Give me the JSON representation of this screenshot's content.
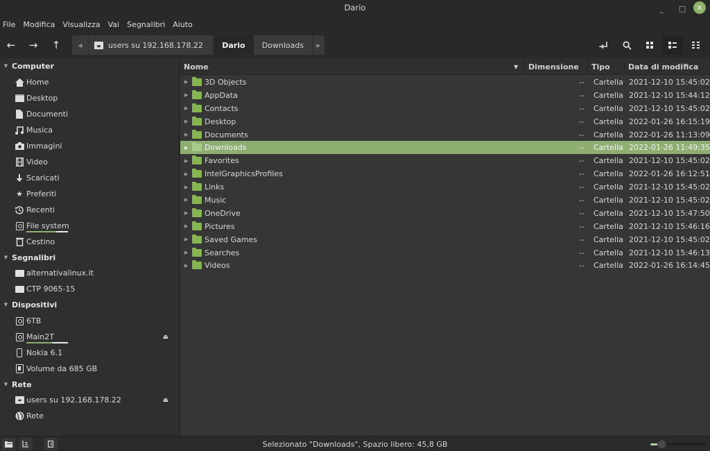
{
  "window": {
    "title": "Dario",
    "minimize_label": "_",
    "maximize_label": "□",
    "close_label": "✕"
  },
  "menubar": [
    "File",
    "Modifica",
    "Visualizza",
    "Vai",
    "Segnalibri",
    "Aiuto"
  ],
  "toolbar": {
    "back_icon": "←",
    "forward_icon": "→",
    "up_icon": "↑",
    "path_left_arrow": "◀",
    "path_right_arrow": "▶",
    "path": [
      {
        "label": "users su 192.168.178.22",
        "icon": "network-share-icon"
      },
      {
        "label": "Dario",
        "active": true
      },
      {
        "label": "Downloads"
      }
    ],
    "toggle_location_icon": "↵",
    "search_icon": "⚲",
    "icon_view_icon": "▦",
    "list_view_icon": "☰",
    "compact_view_icon": "⋮⋮"
  },
  "sidebar": {
    "sections": [
      {
        "title": "Computer",
        "items": [
          {
            "label": "Home",
            "icon": "home-icon"
          },
          {
            "label": "Desktop",
            "icon": "desktop-icon"
          },
          {
            "label": "Documenti",
            "icon": "document-icon"
          },
          {
            "label": "Musica",
            "icon": "music-icon"
          },
          {
            "label": "Immagini",
            "icon": "camera-icon"
          },
          {
            "label": "Video",
            "icon": "film-icon"
          },
          {
            "label": "Scaricati",
            "icon": "download-icon"
          },
          {
            "label": "Preferiti",
            "icon": "star-icon"
          },
          {
            "label": "Recenti",
            "icon": "history-icon"
          },
          {
            "label": "File system",
            "icon": "drive-icon",
            "usage": 0.72
          },
          {
            "label": "Cestino",
            "icon": "trash-icon"
          }
        ]
      },
      {
        "title": "Segnalibri",
        "items": [
          {
            "label": "alternativalinux.it",
            "icon": "folder-icon"
          },
          {
            "label": "CTP 9065-15",
            "icon": "folder-icon"
          }
        ]
      },
      {
        "title": "Dispositivi",
        "items": [
          {
            "label": "6TB",
            "icon": "drive-icon"
          },
          {
            "label": "Main2T",
            "icon": "drive-icon",
            "usage": 0.62,
            "eject": true
          },
          {
            "label": "Nokia 6.1",
            "icon": "phone-icon"
          },
          {
            "label": "Volume da 685 GB",
            "icon": "volume-icon"
          }
        ]
      },
      {
        "title": "Rete",
        "items": [
          {
            "label": "users su 192.168.178.22",
            "icon": "network-share-icon",
            "eject": true
          },
          {
            "label": "Rete",
            "icon": "globe-icon"
          }
        ]
      }
    ],
    "eject_icon": "⏏"
  },
  "filelist": {
    "columns": {
      "name": "Nome",
      "size": "Dimensione",
      "type": "Tipo",
      "modified": "Data di modifica"
    },
    "sort_indicator": "▼",
    "rows": [
      {
        "name": "3D Objects",
        "size": "--",
        "type": "Cartella",
        "modified": "2021-12-10 15:45:02"
      },
      {
        "name": "AppData",
        "size": "--",
        "type": "Cartella",
        "modified": "2021-12-10 15:44:12"
      },
      {
        "name": "Contacts",
        "size": "--",
        "type": "Cartella",
        "modified": "2021-12-10 15:45:02"
      },
      {
        "name": "Desktop",
        "size": "--",
        "type": "Cartella",
        "modified": "2022-01-26 16:15:19"
      },
      {
        "name": "Documents",
        "size": "--",
        "type": "Cartella",
        "modified": "2022-01-26 11:13:09"
      },
      {
        "name": "Downloads",
        "size": "--",
        "type": "Cartella",
        "modified": "2022-01-26 11:49:35",
        "selected": true
      },
      {
        "name": "Favorites",
        "size": "--",
        "type": "Cartella",
        "modified": "2021-12-10 15:45:02"
      },
      {
        "name": "IntelGraphicsProfiles",
        "size": "--",
        "type": "Cartella",
        "modified": "2022-01-26 16:12:51"
      },
      {
        "name": "Links",
        "size": "--",
        "type": "Cartella",
        "modified": "2021-12-10 15:45:02"
      },
      {
        "name": "Music",
        "size": "--",
        "type": "Cartella",
        "modified": "2021-12-10 15:45:02"
      },
      {
        "name": "OneDrive",
        "size": "--",
        "type": "Cartella",
        "modified": "2021-12-10 15:47:50"
      },
      {
        "name": "Pictures",
        "size": "--",
        "type": "Cartella",
        "modified": "2021-12-10 15:46:16"
      },
      {
        "name": "Saved Games",
        "size": "--",
        "type": "Cartella",
        "modified": "2021-12-10 15:45:02"
      },
      {
        "name": "Searches",
        "size": "--",
        "type": "Cartella",
        "modified": "2021-12-10 15:46:13"
      },
      {
        "name": "Videos",
        "size": "--",
        "type": "Cartella",
        "modified": "2022-01-26 16:14:45"
      }
    ]
  },
  "statusbar": {
    "text": "Selezionato \"Downloads\", Spazio libero: 45,8 GB",
    "zoom_level": 0.2,
    "places_icon": "▬",
    "tree_icon": "⊫",
    "toggle_sidebar_icon": "▯"
  },
  "colors": {
    "accent": "#8fae72",
    "folder": "#86b551",
    "close_button": "#8fb36a",
    "background": "#2b2b2b"
  }
}
